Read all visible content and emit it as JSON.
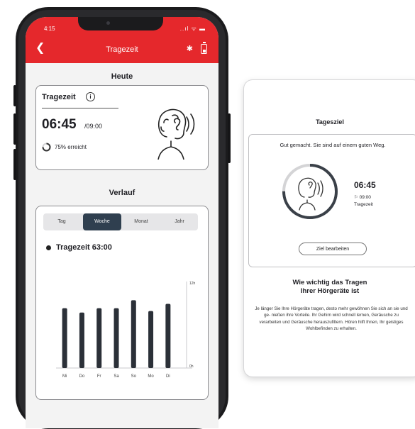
{
  "status_bar": {
    "time": "4:15",
    "icons": "..ıl ᯤ ▬"
  },
  "app_bar": {
    "title": "Tragezeit",
    "back_glyph": "❮",
    "bluetooth_glyph": "✱"
  },
  "today": {
    "heading": "Heute",
    "card_title": "Tragezeit",
    "info_glyph": "i",
    "time_value": "06:45",
    "goal_value": "/09:00",
    "progress_text": "75% erreicht",
    "progress_fraction": 0.75
  },
  "history": {
    "heading": "Verlauf",
    "tabs": [
      "Tag",
      "Woche",
      "Monat",
      "Jahr"
    ],
    "active_tab": "Woche",
    "series_label": "Tragezeit 63:00"
  },
  "chart_data": {
    "type": "bar",
    "categories": [
      "Mi",
      "Do",
      "Fr",
      "Sa",
      "So",
      "Mo",
      "Di"
    ],
    "values": [
      8.3,
      7.7,
      8.3,
      8.3,
      9.4,
      7.9,
      8.9
    ],
    "y_ticks": [
      "12h",
      "0h"
    ],
    "ylim": [
      0,
      12
    ],
    "bar_color": "#2b3038"
  },
  "goal_card": {
    "title": "Tagesziel",
    "message": "Gut gemacht. Sie sind auf einem guten Weg.",
    "time_value": "06:45",
    "goal_line": "⚐ 09:00",
    "label": "Tragezeit",
    "progress_fraction": 0.75,
    "button_label": "Ziel bearbeiten",
    "info_heading_line1": "Wie wichtig das Tragen",
    "info_heading_line2": "Ihrer Hörgeräte ist",
    "info_text": "Je länger Sie Ihre Hörgeräte tragen, desto mehr gewöhnen Sie sich an sie und ge- nießen ihre Vorteile. Ihr Gehirn wird schnell lernen, Geräusche zu verarbeiten und Geräusche herauszufiltern. Hören hilft Ihnen, Ihr geistiges Wohlbefinden zu erhalten."
  },
  "colors": {
    "accent": "#e5282c",
    "tab_active": "#2f3f4f",
    "ring_progress": "#3a4048",
    "ring_track": "#d4d4d6"
  }
}
